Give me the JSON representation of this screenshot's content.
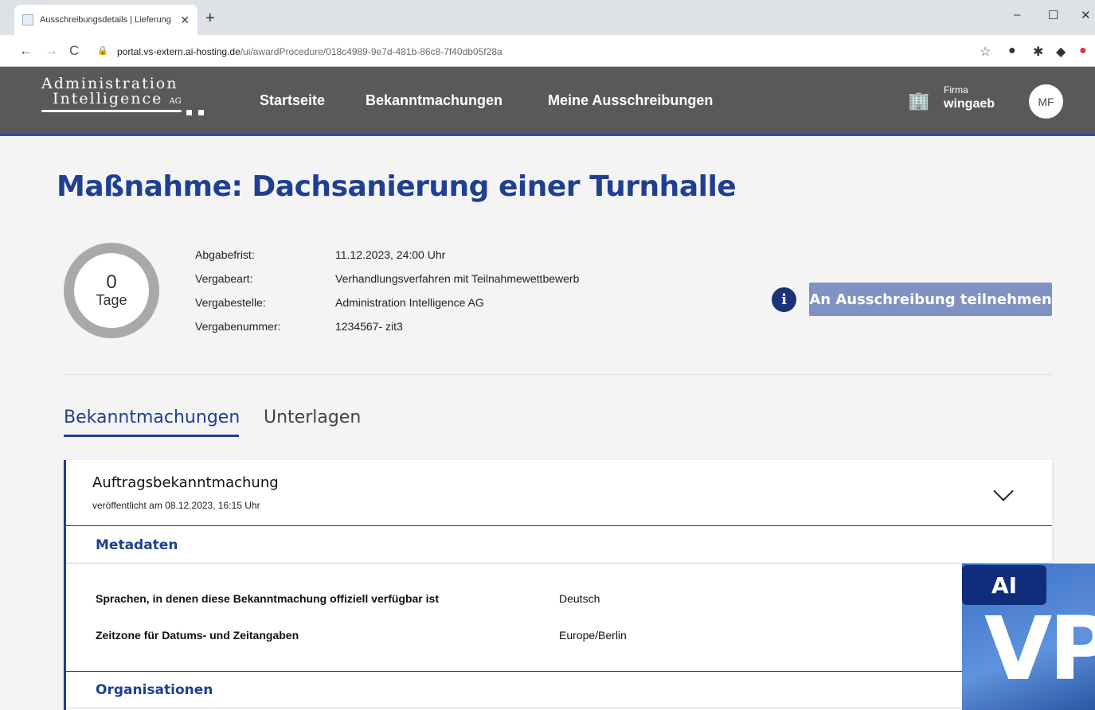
{
  "browser": {
    "tab_title": "Ausschreibungsdetails | Lieferung",
    "url_host": "portal.vs-extern.ai-hosting.de",
    "url_path": "/ui/awardProcedure/018c4989-9e7d-481b-86c8-7f40db05f28a"
  },
  "header": {
    "logo_line1": "Administration",
    "logo_line2": "Intelligence",
    "logo_ag": "AG",
    "nav": [
      "Startseite",
      "Bekanntmachungen",
      "Meine Ausschreibungen"
    ],
    "firm_label": "Firma",
    "firm_name": "wingaeb",
    "avatar_initials": "MF"
  },
  "page": {
    "title": "Maßnahme: Dachsanierung einer Turnhalle",
    "countdown": {
      "value": "0",
      "unit": "Tage"
    },
    "details": [
      {
        "label": "Abgabefrist:",
        "value": "11.12.2023, 24:00 Uhr"
      },
      {
        "label": "Vergabeart:",
        "value": "Verhandlungsverfahren mit Teilnahmewettbewerb"
      },
      {
        "label": "Vergabestelle:",
        "value": "Administration Intelligence AG"
      },
      {
        "label": "Vergabenummer:",
        "value": "1234567- zit3"
      }
    ],
    "join_button": "An Ausschreibung teilnehmen",
    "tabs": [
      "Bekanntmachungen",
      "Unterlagen"
    ]
  },
  "notice": {
    "title": "Auftragsbekanntmachung",
    "published": "veröffentlicht am 08.12.2023, 16:15 Uhr",
    "sections": [
      {
        "heading": "Metadaten",
        "rows": [
          {
            "label": "Sprachen, in denen diese Bekanntmachung offiziell verfügbar ist",
            "value": "Deutsch"
          },
          {
            "label": "Zeitzone für Datums- und Zeitangaben",
            "value": "Europe/Berlin"
          }
        ]
      },
      {
        "heading": "Organisationen"
      }
    ]
  },
  "badge": {
    "line1": "AI",
    "line2": "VP"
  },
  "colors": {
    "primary": "#1f3f91",
    "header_bg": "#595959",
    "button": "#7f92c2"
  }
}
